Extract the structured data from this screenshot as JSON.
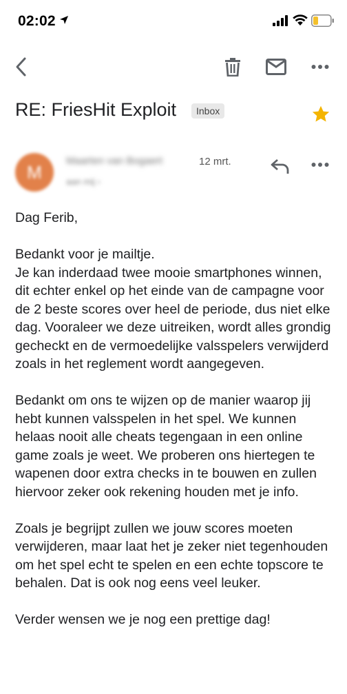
{
  "status_bar": {
    "time": "02:02"
  },
  "toolbar": {
    "back_icon": "chevron-left-icon",
    "trash_icon": "trash-icon",
    "mail_icon": "mail-icon",
    "more_icon": "more-horizontal-icon"
  },
  "email": {
    "subject": "RE: FriesHit Exploit",
    "label": "Inbox",
    "starred": true,
    "star_color": "#f4b400",
    "sender": {
      "avatar_letter": "M",
      "avatar_color": "#e2814a",
      "name": "Maarten van Bogaert",
      "to": "aan mij ›",
      "date": "12 mrt."
    },
    "body": [
      "Dag Ferib,",
      "Bedankt voor je mailtje.\nJe kan inderdaad twee mooie smartphones winnen, dit echter enkel op het einde van de campagne voor de 2 beste scores over heel de periode, dus niet elke dag. Vooraleer we deze uitreiken, wordt alles grondig gecheckt en de vermoedelijke valsspelers verwijderd zoals in het reglement wordt aangegeven.",
      "Bedankt om ons te wijzen op de manier waarop jij hebt kunnen valsspelen in het spel. We kunnen helaas nooit alle cheats tegengaan in een online game zoals je weet. We proberen ons hiertegen te wapenen door extra checks in te bouwen en zullen hiervoor zeker ook rekening houden met je info.",
      "Zoals je begrijpt zullen we jouw scores moeten verwijderen, maar laat het je zeker niet tegenhouden om het spel echt te spelen en een echte topscore te behalen. Dat is ook nog eens veel leuker.",
      "Verder wensen we je nog een prettige dag!"
    ]
  }
}
